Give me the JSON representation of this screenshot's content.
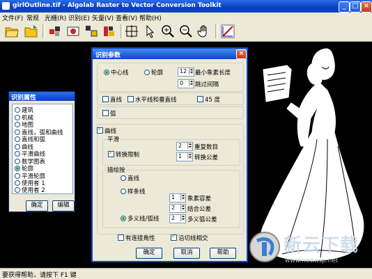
{
  "window": {
    "title": "girlOutline.tif - Algolab Raster to Vector Conversion Toolkit"
  },
  "menu": [
    "文件(F)",
    "常规",
    "光栅(R)",
    "识别(E)",
    "矢量(V)",
    "查看(V)",
    "帮助(H)"
  ],
  "toolbar": [
    "open-folder-icon",
    "save-folder-icon",
    "raster-tool-1-icon",
    "raster-tool-2-icon",
    "vector-tool-1-icon",
    "vector-tool-2-icon",
    "fit-window-icon",
    "pointer-icon",
    "zoom-in-icon",
    "zoom-out-icon",
    "pan-hand-icon",
    "vectorize-icon"
  ],
  "props_panel": {
    "title": "识别属性",
    "items": [
      "建筑",
      "机械",
      "地图",
      "直线，弧和曲线",
      "直线和弧",
      "曲线",
      "平滑曲线",
      "数学图表",
      "轮廓",
      "平滑轮廓",
      "使用者 1",
      "使用者 2"
    ],
    "selected_index": 8,
    "ok_label": "确定",
    "edit_label": "编辑"
  },
  "dialog": {
    "title": "识别参数",
    "centerline_label": "中心线",
    "outline_label": "轮廓",
    "centerline_selected": true,
    "min_length_value": "12",
    "min_length_label": "最小象素长度",
    "gap_value": "0",
    "gap_label": "跳过间隔",
    "line_label": "直线",
    "hv_label": "水平线和垂直线",
    "deg45_label": "45 度",
    "arc_label": "弧",
    "curve_label": "曲线",
    "curve_checked": true,
    "smooth_group": "平滑",
    "convert_limit_label": "转换限制",
    "convert_limit_checked": true,
    "repeat_value": "2",
    "repeat_label": "重复数目",
    "tolerance_value": "1",
    "tolerance_label": "转换公差",
    "draw_group": "描绘按",
    "draw_line_label": "直线",
    "draw_spline_label": "样条线",
    "draw_poly_label": "多义线/弧线",
    "draw_selected": "poly",
    "pixel_tol_value": "1",
    "pixel_tol_label": "象素容差",
    "join_tol_value": "2",
    "join_tol_label": "结合公差",
    "arc_tol_value": "2",
    "arc_tol_label": "多义弧公差",
    "preserve_label": "有连接角性",
    "tangent_label": "沿切线相交",
    "tangent_checked": true,
    "ok_label": "确定",
    "cancel_label": "取消",
    "help_label": "帮助"
  },
  "watermark": {
    "text": "新云下载",
    "url": "www.newasp.net"
  },
  "status": {
    "text": "要获得帮助，请按下 F1 键"
  }
}
